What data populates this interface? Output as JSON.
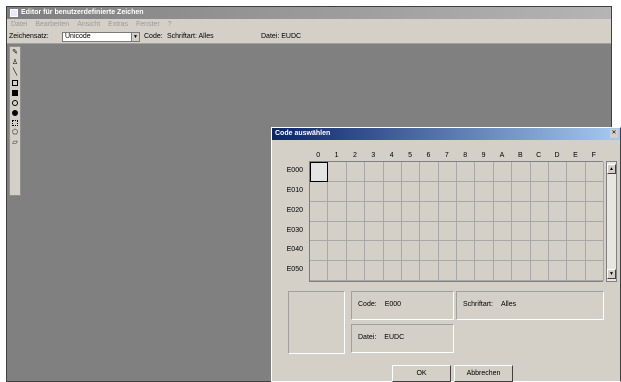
{
  "app": {
    "title": "Editor für benutzerdefinierte Zeichen",
    "menu": [
      "Datei",
      "Bearbeiten",
      "Ansicht",
      "Extras",
      "Fenster",
      "?"
    ],
    "toolbar": {
      "charset_label": "Zeichensatz:",
      "charset_value": "Unicode",
      "code_label": "Code:",
      "font_text": "Schriftart: Alles",
      "file_text": "Datei: EUDC"
    },
    "tools": [
      "pencil-icon",
      "brush-icon",
      "line-icon",
      "rectangle-icon",
      "filled-rectangle-icon",
      "ellipse-icon",
      "filled-ellipse-icon",
      "select-rectangle-icon",
      "select-freeform-icon",
      "eraser-icon"
    ]
  },
  "dialog": {
    "title": "Code auswählen",
    "col_headers": [
      "0",
      "1",
      "2",
      "3",
      "4",
      "5",
      "6",
      "7",
      "8",
      "9",
      "A",
      "B",
      "C",
      "D",
      "E",
      "F"
    ],
    "row_headers": [
      "E000",
      "E010",
      "E020",
      "E030",
      "E040",
      "E050"
    ],
    "selected_cell": "E000",
    "code_label": "Code:",
    "code_value": "E000",
    "font_label": "Schriftart:",
    "font_value": "Alles",
    "file_label": "Datei:",
    "file_value": "EUDC",
    "ok_label": "OK",
    "cancel_label": "Abbrechen"
  }
}
